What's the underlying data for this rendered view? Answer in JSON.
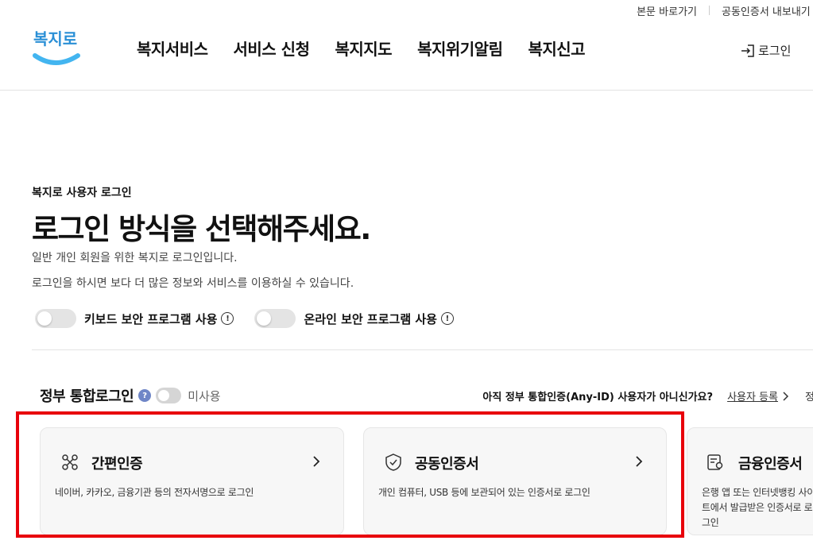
{
  "util": {
    "skip": "본문 바로가기",
    "cert_export": "공동인증서 내보내기"
  },
  "header": {
    "logo_text": "복지로",
    "nav": [
      "복지서비스",
      "서비스 신청",
      "복지지도",
      "복지위기알림",
      "복지신고"
    ],
    "login": "로그인"
  },
  "main": {
    "subtitle": "복지로 사용자 로그인",
    "title": "로그인 방식을 선택해주세요.",
    "desc1": "일반 개인 회원을 위한 복지로 로그인입니다.",
    "desc2": "로그인을 하시면 보다 더 많은 정보와 서비스를 이용하실 수 있습니다.",
    "toggle_keyboard": "키보드 보안 프로그램 사용",
    "toggle_online": "온라인 보안 프로그램 사용"
  },
  "gov": {
    "title": "정부 통합로그인",
    "help": "?",
    "status": "미사용",
    "anyid_question": "아직 정부 통합인증(Any-ID) 사용자가 아니신가요?",
    "register": "사용자 등록",
    "more": "정"
  },
  "cards": [
    {
      "title": "간편인증",
      "desc": "네이버, 카카오, 금융기관 등의 전자서명으로 로그인",
      "icon": "simple-auth-icon"
    },
    {
      "title": "공동인증서",
      "desc": "개인 컴퓨터, USB 등에 보관되어 있는 인증서로 로그인",
      "icon": "shield-check-icon"
    },
    {
      "title": "금융인증서",
      "desc": "은행 앱 또는 인터넷뱅킹 사이트에서 발급받은 인증서로 로그인",
      "icon": "certificate-icon"
    }
  ],
  "colors": {
    "brand_blue": "#2a8fd6",
    "brand_sky": "#43b5f0",
    "highlight": "#e8000b"
  }
}
